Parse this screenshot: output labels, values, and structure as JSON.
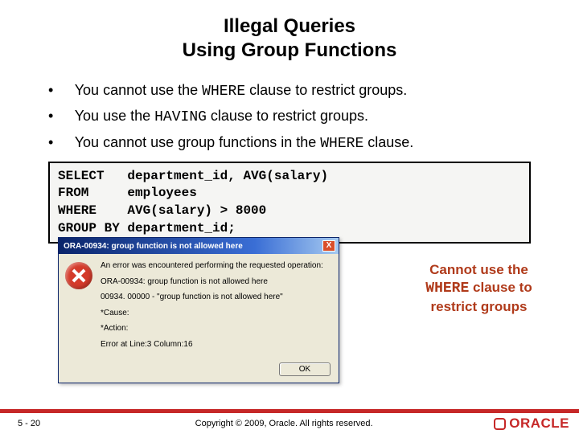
{
  "title": {
    "line1": "Illegal Queries",
    "line2": "Using Group Functions"
  },
  "bullets": {
    "b1a": "You cannot use the ",
    "b1kw": "WHERE",
    "b1b": " clause to restrict groups.",
    "b2a": "You use the ",
    "b2kw": "HAVING",
    "b2b": " clause to restrict groups.",
    "b3a": "You cannot use group functions in the ",
    "b3kw": "WHERE",
    "b3b": " clause."
  },
  "code": "SELECT   department_id, AVG(salary)\nFROM     employees\nWHERE    AVG(salary) > 8000\nGROUP BY department_id;",
  "dialog": {
    "title": "ORA-00934: group function is not allowed here",
    "close": "X",
    "line1": "An error was encountered performing the requested operation:",
    "line2": "ORA-00934: group function is not allowed here",
    "line3": "00934. 00000 - \"group function is not allowed here\"",
    "cause": "*Cause:",
    "action": "*Action:",
    "vendor": "Error at Line:3 Column:16",
    "ok": "OK"
  },
  "callout": {
    "a": "Cannot use the",
    "kw": "WHERE",
    "b": " clause to",
    "c": "restrict groups"
  },
  "footer": {
    "page": "5 - 20",
    "copyright": "Copyright © 2009, Oracle. All rights reserved.",
    "brand": "ORACLE"
  }
}
